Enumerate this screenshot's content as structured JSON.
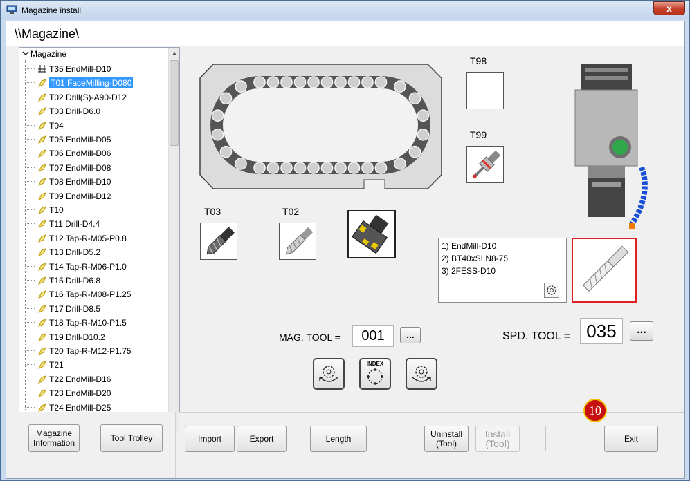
{
  "window": {
    "title": "Magazine install",
    "close_label": "x"
  },
  "path": "\\\\Magazine\\",
  "tree": {
    "root": "Magazine",
    "items": [
      {
        "label": "T35 EndMill-D10",
        "icon": "spindle-icon"
      },
      {
        "label": "T01 FaceMilling-D080",
        "icon": "tool-icon",
        "selected": true
      },
      {
        "label": "T02 Drill(S)-A90-D12",
        "icon": "tool-icon"
      },
      {
        "label": "T03 Drill-D6.0",
        "icon": "tool-icon"
      },
      {
        "label": "T04",
        "icon": "tool-icon"
      },
      {
        "label": "T05 EndMill-D05",
        "icon": "tool-icon"
      },
      {
        "label": "T06 EndMill-D06",
        "icon": "tool-icon"
      },
      {
        "label": "T07 EndMill-D08",
        "icon": "tool-icon"
      },
      {
        "label": "T08 EndMill-D10",
        "icon": "tool-icon"
      },
      {
        "label": "T09 EndMill-D12",
        "icon": "tool-icon"
      },
      {
        "label": "T10",
        "icon": "tool-icon"
      },
      {
        "label": "T11 Drill-D4.4",
        "icon": "tool-icon"
      },
      {
        "label": "T12 Tap-R-M05-P0.8",
        "icon": "tool-icon"
      },
      {
        "label": "T13 Drill-D5.2",
        "icon": "tool-icon"
      },
      {
        "label": "T14 Tap-R-M06-P1.0",
        "icon": "tool-icon"
      },
      {
        "label": "T15 Drill-D6.8",
        "icon": "tool-icon"
      },
      {
        "label": "T16 Tap-R-M08-P1.25",
        "icon": "tool-icon"
      },
      {
        "label": "T17 Drill-D8.5",
        "icon": "tool-icon"
      },
      {
        "label": "T18 Tap-R-M10-P1.5",
        "icon": "tool-icon"
      },
      {
        "label": "T19 Drill-D10.2",
        "icon": "tool-icon"
      },
      {
        "label": "T20 Tap-R-M12-P1.75",
        "icon": "tool-icon"
      },
      {
        "label": "T21",
        "icon": "tool-icon"
      },
      {
        "label": "T22 EndMill-D16",
        "icon": "tool-icon"
      },
      {
        "label": "T23 EndMill-D20",
        "icon": "tool-icon"
      },
      {
        "label": "T24 EndMill-D25",
        "icon": "tool-icon"
      }
    ]
  },
  "slots": {
    "t98": "T98",
    "t99": "T99",
    "t03": "T03",
    "t02": "T02"
  },
  "tool_info": {
    "line1": "1) EndMill-D10",
    "line2": "2) BT40xSLN8-75",
    "line3": "3) 2FESS-D10"
  },
  "mag_tool": {
    "label": "MAG. TOOL =",
    "value": "001",
    "browse": "..."
  },
  "spd_tool": {
    "label": "SPD. TOOL =",
    "value": "035",
    "browse": "..."
  },
  "index_label": "INDEX",
  "buttons": {
    "magazine_info": "Magazine Information",
    "tool_trolley": "Tool Trolley",
    "import": "Import",
    "export": "Export",
    "length": "Length",
    "uninstall": "Uninstall (Tool)",
    "install": "Install (Tool)",
    "exit": "Exit"
  },
  "badge": "10",
  "colors": {
    "selection": "#3399ff",
    "highlight_border": "#e02020",
    "badge": "#c81010",
    "coolant": "#1a4fd8"
  }
}
